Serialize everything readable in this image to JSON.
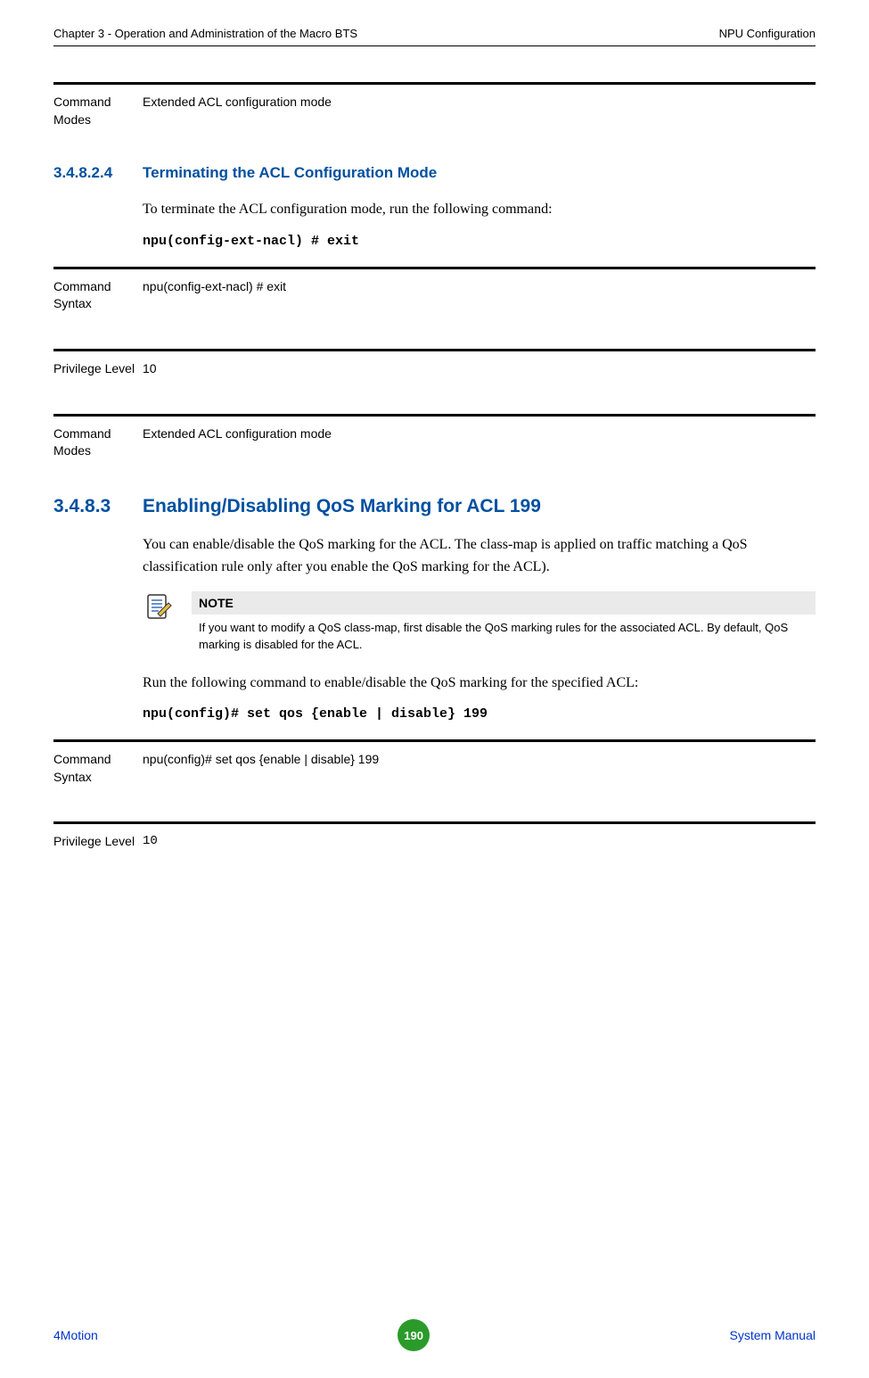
{
  "header": {
    "left": "Chapter 3 - Operation and Administration of the Macro BTS",
    "right": "NPU Configuration"
  },
  "def1": {
    "label": "Command Modes",
    "value": "Extended ACL configuration mode"
  },
  "sec1": {
    "num": "3.4.8.2.4",
    "title": "Terminating the ACL Configuration Mode",
    "para": "To terminate the ACL configuration mode, run the following command:",
    "code": "npu(config-ext-nacl) # exit"
  },
  "def2": {
    "label": "Command Syntax",
    "value": "npu(config-ext-nacl) # exit"
  },
  "def3": {
    "label": "Privilege Level",
    "value": "10"
  },
  "def4": {
    "label": "Command Modes",
    "value": "Extended ACL configuration mode"
  },
  "sec2": {
    "num": "3.4.8.3",
    "title": "Enabling/Disabling QoS Marking for ACL 199",
    "para1": "You can enable/disable the QoS marking for the ACL. The class-map is applied on traffic matching a QoS classification rule only after you enable the QoS marking for the ACL).",
    "note_header": "NOTE",
    "note_text": "If you want to modify a QoS class-map, first disable the QoS marking rules for the associated ACL. By default, QoS marking is disabled for the ACL.",
    "para2": "Run the following command to enable/disable the QoS marking for the specified ACL:",
    "code": "npu(config)# set qos {enable | disable} 199"
  },
  "def5": {
    "label": "Command Syntax",
    "value": "npu(config)# set qos {enable | disable} 199"
  },
  "def6": {
    "label": "Privilege Level",
    "value": "10"
  },
  "footer": {
    "left": "4Motion",
    "page": "190",
    "right": "System Manual"
  }
}
